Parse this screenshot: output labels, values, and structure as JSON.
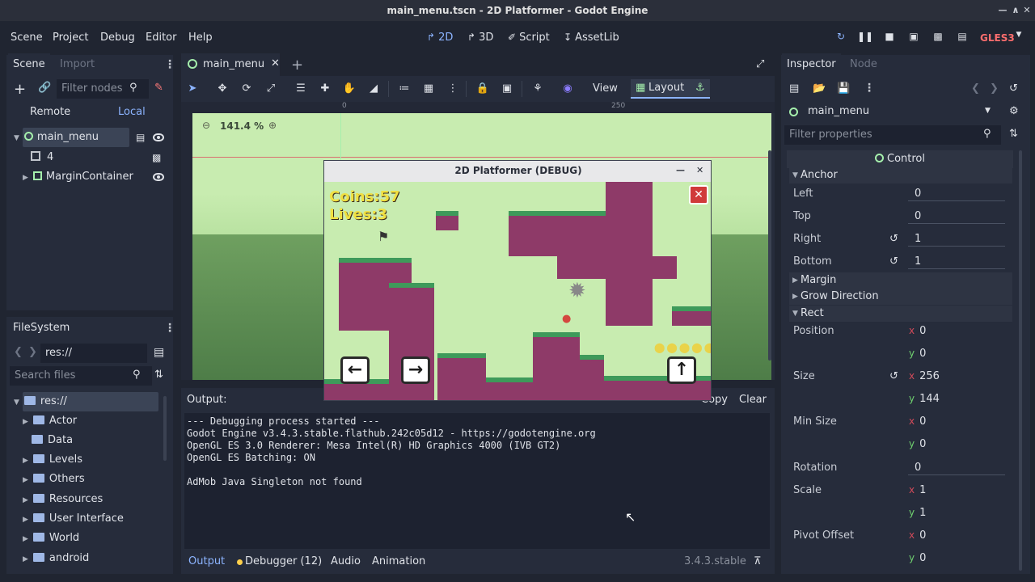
{
  "window": {
    "title": "main_menu.tscn - 2D Platformer - Godot Engine",
    "minimize_icon": "minimize-icon",
    "maximize_icon": "maximize-icon",
    "close_icon": "close-icon"
  },
  "menu": [
    "Scene",
    "Project",
    "Debug",
    "Editor",
    "Help"
  ],
  "workspaces": [
    {
      "label": "2D",
      "icon": "2d-icon",
      "active": true
    },
    {
      "label": "3D",
      "icon": "3d-icon",
      "active": false
    },
    {
      "label": "Script",
      "icon": "script-icon",
      "active": false
    },
    {
      "label": "AssetLib",
      "icon": "assetlib-icon",
      "active": false
    }
  ],
  "renderer": "GLES3",
  "scene_dock": {
    "tabs": [
      "Scene",
      "Import"
    ],
    "filter_placeholder": "Filter nodes",
    "remote_label": "Remote",
    "local_label": "Local",
    "nodes": [
      {
        "label": "main_menu",
        "type": "control"
      },
      {
        "label": "4",
        "type": "node"
      },
      {
        "label": "MarginContainer",
        "type": "container"
      }
    ]
  },
  "filesystem": {
    "tab": "FileSystem",
    "path": "res://",
    "search_placeholder": "Search files",
    "root": "res://",
    "folders": [
      "Actor",
      "Data",
      "Levels",
      "Others",
      "Resources",
      "User Interface",
      "World",
      "android"
    ]
  },
  "editor": {
    "scene_tab": "main_menu",
    "zoom": "141.4 %",
    "ruler_marks": [
      "0",
      "250"
    ],
    "view_label": "View",
    "layout_label": "Layout"
  },
  "game_window": {
    "title": "2D Platformer (DEBUG)",
    "coins": "Coins:57",
    "lives": "Lives:3"
  },
  "output": {
    "label": "Output:",
    "copy_label": "Copy",
    "clear_label": "Clear",
    "lines": [
      "--- Debugging process started ---",
      "Godot Engine v3.4.3.stable.flathub.242c05d12 - https://godotengine.org",
      "OpenGL ES 3.0 Renderer: Mesa Intel(R) HD Graphics 4000 (IVB GT2)",
      "OpenGL ES Batching: ON",
      "",
      "AdMob Java Singleton not found"
    ]
  },
  "bottom_tabs": [
    "Output",
    "Debugger (12)",
    "Audio",
    "Animation"
  ],
  "version": "3.4.3.stable",
  "inspector": {
    "tabs": [
      "Inspector",
      "Node"
    ],
    "node_name": "main_menu",
    "filter_placeholder": "Filter properties",
    "class_name": "Control",
    "anchor": {
      "title": "Anchor",
      "left_label": "Left",
      "left": "0",
      "top_label": "Top",
      "top": "0",
      "right_label": "Right",
      "right": "1",
      "bottom_label": "Bottom",
      "bottom": "1"
    },
    "margin_label": "Margin",
    "grow_label": "Grow Direction",
    "rect": {
      "title": "Rect",
      "position_label": "Position",
      "position_x": "0",
      "position_y": "0",
      "size_label": "Size",
      "size_x": "256",
      "size_y": "144",
      "min_size_label": "Min Size",
      "min_x": "0",
      "min_y": "0",
      "rotation_label": "Rotation",
      "rotation": "0",
      "scale_label": "Scale",
      "scale_x": "1",
      "scale_y": "1",
      "pivot_label": "Pivot Offset",
      "pivot_x": "0",
      "pivot_y": "0"
    },
    "axis_x": "x",
    "axis_y": "y"
  },
  "colors": {
    "accent": "#8cb4ff",
    "background": "#202531",
    "panel": "#262c3b",
    "control_node": "#a5efac",
    "gles": "#ff6e6e"
  }
}
